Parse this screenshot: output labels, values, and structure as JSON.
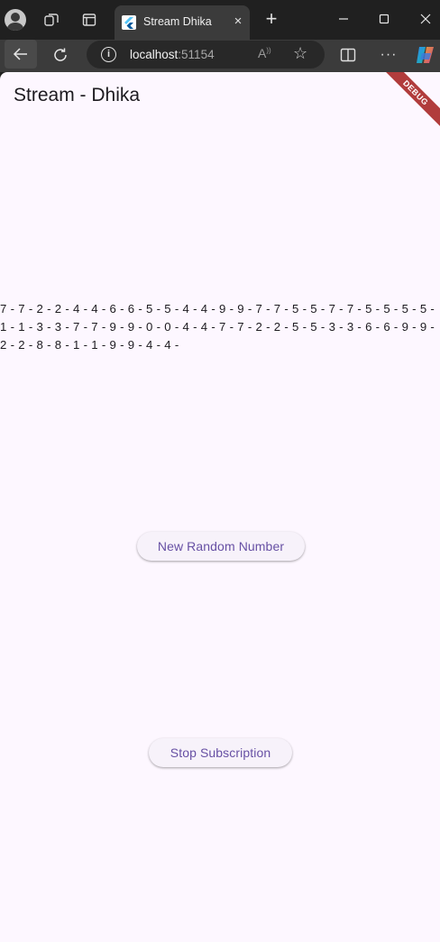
{
  "browser": {
    "tab": {
      "title": "Stream Dhika"
    },
    "address": {
      "host": "localhost",
      "port": ":51154"
    },
    "new_tab_symbol": "+",
    "tab_close_symbol": "×",
    "readaloud_symbol": "A͡",
    "more_symbol": "···"
  },
  "app": {
    "title": "Stream - Dhika",
    "debug_banner": "DEBUG",
    "stream_values": "7 - 7 - 2 - 2 - 4 - 4 - 6 - 6 - 5 - 5 - 4 - 4 - 9 - 9 - 7 - 7 - 5 - 5 - 7 - 7 - 5 - 5 - 5 - 5 - 1 - 1 - 3 - 3 - 7 - 7 - 9 - 9 - 0 - 0 - 4 - 4 - 7 - 7 - 2 - 2 - 5 - 5 - 3 - 3 - 6 - 6 - 9 - 9 - 2 - 2 - 8 - 8 - 1 - 1 - 9 - 9 - 4 - 4 -",
    "new_random_button": "New Random Number",
    "stop_button": "Stop Subscription"
  },
  "colors": {
    "page_background": "#fdf7ff",
    "button_text": "#6750a4",
    "button_background": "#f7f2fa",
    "debug_banner": "#b13c3c"
  },
  "icons": [
    "profile-icon",
    "workspaces-icon",
    "tab-actions-icon",
    "flutter-favicon",
    "close-icon",
    "plus-icon",
    "minimize-icon",
    "maximize-icon",
    "window-close-icon",
    "back-arrow-icon",
    "reload-icon",
    "info-icon",
    "read-aloud-icon",
    "favorite-star-icon",
    "split-screen-icon",
    "more-icon",
    "copilot-icon"
  ]
}
